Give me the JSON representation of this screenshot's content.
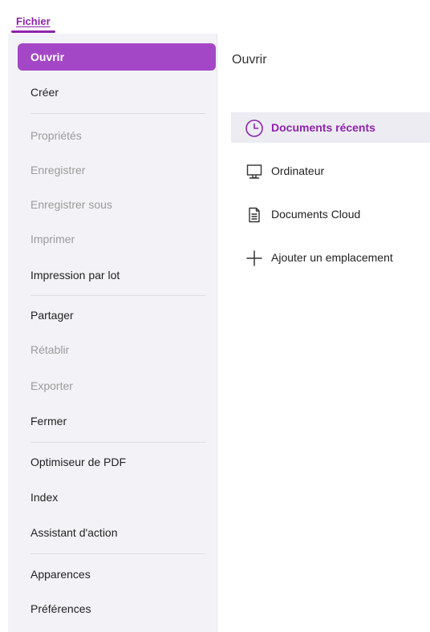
{
  "tabs": {
    "file_label": "Fichier"
  },
  "sidebar": {
    "items": [
      {
        "label": "Ouvrir",
        "state": "active"
      },
      {
        "label": "Créer",
        "state": "enabled"
      },
      {
        "label": "Propriétés",
        "state": "disabled"
      },
      {
        "label": "Enregistrer",
        "state": "disabled"
      },
      {
        "label": "Enregistrer sous",
        "state": "disabled"
      },
      {
        "label": "Imprimer",
        "state": "disabled"
      },
      {
        "label": "Impression par lot",
        "state": "enabled"
      },
      {
        "label": "Partager",
        "state": "enabled"
      },
      {
        "label": "Rétablir",
        "state": "disabled"
      },
      {
        "label": "Exporter",
        "state": "disabled"
      },
      {
        "label": "Fermer",
        "state": "enabled"
      },
      {
        "label": "Optimiseur de PDF",
        "state": "enabled"
      },
      {
        "label": "Index",
        "state": "enabled"
      },
      {
        "label": "Assistant d'action",
        "state": "enabled"
      },
      {
        "label": "Apparences",
        "state": "enabled"
      },
      {
        "label": "Préférences",
        "state": "enabled"
      }
    ]
  },
  "main": {
    "title": "Ouvrir",
    "locations": [
      {
        "label": "Documents récents",
        "icon": "clock-icon",
        "selected": true
      },
      {
        "label": "Ordinateur",
        "icon": "computer-icon",
        "selected": false
      },
      {
        "label": "Documents Cloud",
        "icon": "document-icon",
        "selected": false
      },
      {
        "label": "Ajouter un emplacement",
        "icon": "plus-icon",
        "selected": false
      }
    ]
  },
  "colors": {
    "accent": "#8E24AA",
    "active_menu_background": "#A447C6",
    "selected_location_background": "#ECECF2",
    "sidebar_background": "#F3F3F7",
    "disabled_text": "#9B9B9B"
  }
}
